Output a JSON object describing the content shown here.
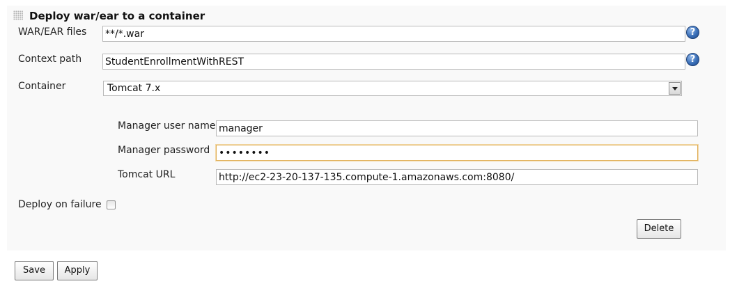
{
  "section": {
    "title": "Deploy war/ear to a container"
  },
  "fields": {
    "war_files": {
      "label": "WAR/EAR files",
      "value": "**/*.war"
    },
    "context_path": {
      "label": "Context path",
      "value": "StudentEnrollmentWithREST"
    },
    "container": {
      "label": "Container",
      "selected": "Tomcat 7.x"
    },
    "manager_user": {
      "label": "Manager user name",
      "value": "manager"
    },
    "manager_password": {
      "label": "Manager password",
      "value": "••••••••"
    },
    "tomcat_url": {
      "label": "Tomcat URL",
      "value": "http://ec2-23-20-137-135.compute-1.amazonaws.com:8080/"
    },
    "deploy_on_failure": {
      "label": "Deploy on failure",
      "checked": false
    }
  },
  "help_icon": {
    "glyph": "?"
  },
  "buttons": {
    "delete": "Delete",
    "save": "Save",
    "apply": "Apply"
  },
  "colors": {
    "section_bg": "#f9f9f9",
    "focus_border": "#e0b05a",
    "help_blue": "#3a6fb8"
  }
}
